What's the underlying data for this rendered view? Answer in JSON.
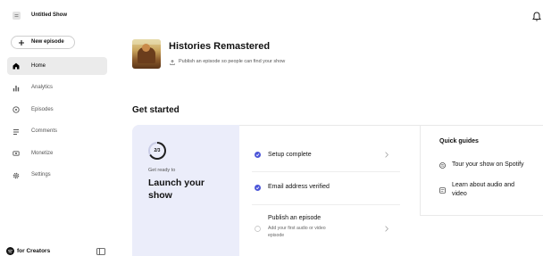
{
  "sidebar": {
    "show_name": "Untitled Show",
    "new_episode_label": "New episode",
    "items": [
      {
        "label": "Home",
        "icon": "home-icon",
        "active": true
      },
      {
        "label": "Analytics",
        "icon": "analytics-icon",
        "active": false
      },
      {
        "label": "Episodes",
        "icon": "episodes-icon",
        "active": false
      },
      {
        "label": "Comments",
        "icon": "comments-icon",
        "active": false
      },
      {
        "label": "Monetize",
        "icon": "monetize-icon",
        "active": false
      },
      {
        "label": "Settings",
        "icon": "settings-icon",
        "active": false
      }
    ],
    "footer_logo_text": "for Creators"
  },
  "header": {
    "show_title": "Histories Remastered",
    "show_subtitle": "Publish an episode so people can find your show"
  },
  "get_started": {
    "heading": "Get started",
    "progress_text": "2/3",
    "progress": {
      "completed": 2,
      "total": 3
    },
    "eyebrow": "Get ready to",
    "title": "Launch your show",
    "steps": [
      {
        "label": "Setup complete",
        "done": true
      },
      {
        "label": "Email address verified",
        "done": true
      },
      {
        "label": "Publish an episode",
        "sub": "Add your first audio or video episode",
        "done": false
      }
    ]
  },
  "quick_guides": {
    "heading": "Quick guides",
    "items": [
      {
        "label": "Tour your show on Spotify",
        "icon": "spotify-icon"
      },
      {
        "label": "Learn about audio and video",
        "icon": "document-icon"
      }
    ]
  },
  "colors": {
    "accent": "#4b55d8",
    "launch_panel": "#ebedfa",
    "ring": "#1f1f1f",
    "ring_track": "#c9cce6",
    "active_nav_bg": "#ebebeb"
  }
}
